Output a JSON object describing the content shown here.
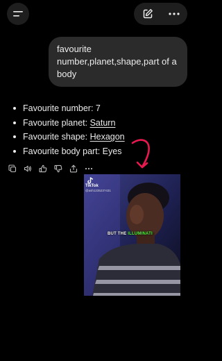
{
  "header": {
    "menu_icon": "menu-icon",
    "new_chat_icon": "edit-icon",
    "more_icon": "more-horizontal-icon"
  },
  "user_message": {
    "text": "favourite number,planet,shape,part of a body"
  },
  "assistant_message": {
    "items": [
      {
        "label": "Favourite number: ",
        "value": "7",
        "linked": false
      },
      {
        "label": "Favourite planet: ",
        "value": "Saturn",
        "linked": true
      },
      {
        "label": "Favourite shape: ",
        "value": "Hexagon",
        "linked": true
      },
      {
        "label": "Favourite body part: ",
        "value": "Eyes",
        "linked": false
      }
    ],
    "actions": [
      "copy-icon",
      "read-aloud-icon",
      "thumbs-up-icon",
      "thumbs-down-icon",
      "share-icon",
      "more-horizontal-icon"
    ]
  },
  "video": {
    "brand": "TikTok",
    "handle": "@ash123523?431",
    "caption_prefix": "BUT THE ",
    "caption_highlight": "ILLUMINATI"
  },
  "colors": {
    "background": "#000000",
    "bubble": "#2b2b2b",
    "button": "#1e1e1e",
    "text": "#ececec",
    "annotation_arrow": "#e8194f",
    "caption_highlight": "#5aff3c"
  }
}
